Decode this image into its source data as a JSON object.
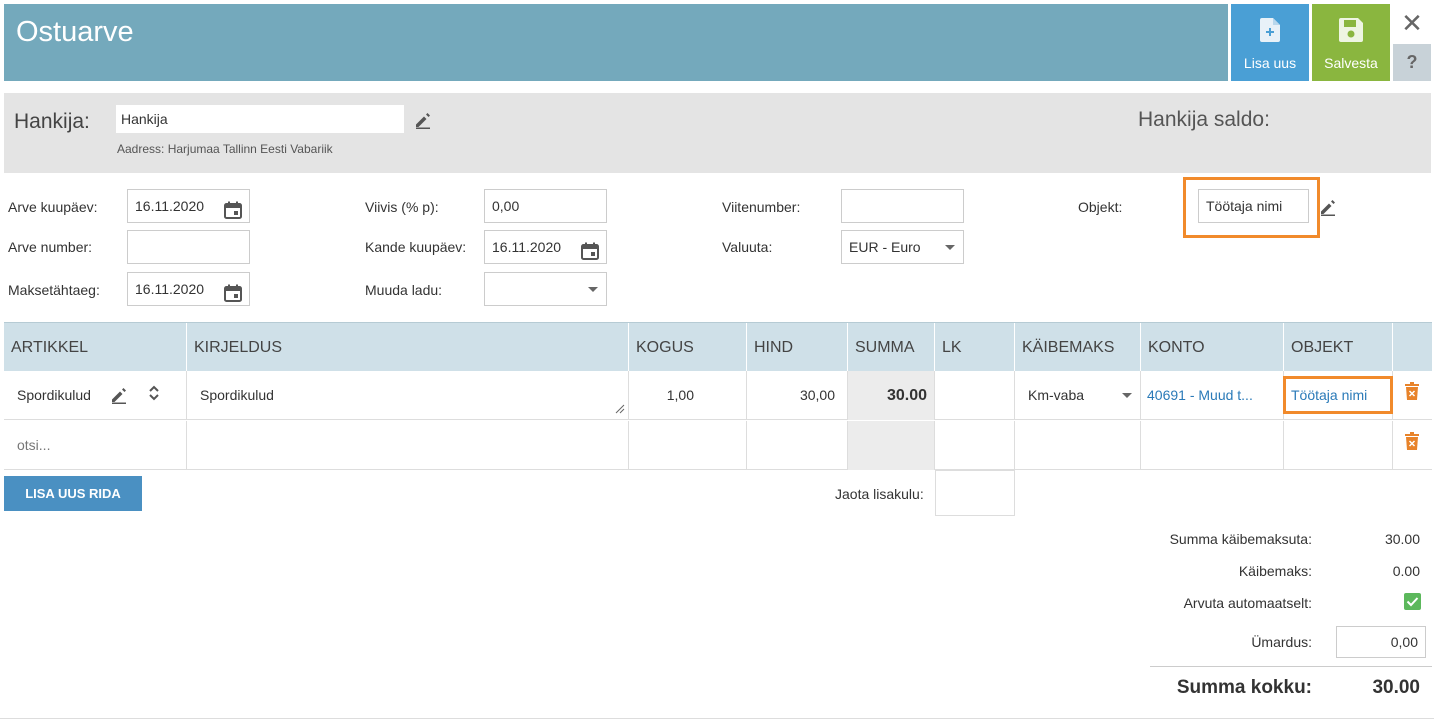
{
  "header": {
    "title": "Ostuarve",
    "add_new_label": "Lisa uus",
    "save_label": "Salvesta",
    "close_label": "✕",
    "help_label": "?"
  },
  "vendor": {
    "label": "Hankija:",
    "value": "Hankija",
    "address": "Aadress: Harjumaa Tallinn Eesti Vabariik",
    "saldo_label": "Hankija saldo:"
  },
  "form": {
    "arve_kuupaev": {
      "label": "Arve kuupäev:",
      "value": "16.11.2020"
    },
    "arve_number": {
      "label": "Arve number:",
      "value": ""
    },
    "maksetahtaeg": {
      "label": "Maksetähtaeg:",
      "value": "16.11.2020"
    },
    "viivis": {
      "label": "Viivis (% p):",
      "value": "0,00"
    },
    "kande_kuupaev": {
      "label": "Kande kuupäev:",
      "value": "16.11.2020"
    },
    "muuda_ladu": {
      "label": "Muuda ladu:",
      "value": ""
    },
    "viitenumber": {
      "label": "Viitenumber:",
      "value": ""
    },
    "valuuta": {
      "label": "Valuuta:",
      "value": "EUR - Euro"
    },
    "objekt": {
      "label": "Objekt:",
      "value": "Töötaja nimi"
    }
  },
  "table": {
    "columns": [
      "ARTIKKEL",
      "KIRJELDUS",
      "KOGUS",
      "HIND",
      "SUMMA",
      "LK",
      "KÄIBEMAKS",
      "KONTO",
      "OBJEKT"
    ],
    "rows": [
      {
        "artikkel": "Spordikulud",
        "kirjeldus": "Spordikulud",
        "kogus": "1,00",
        "hind": "30,00",
        "summa": "30.00",
        "lk": "",
        "kaibemaks": "Km-vaba",
        "konto": "40691 - Muud t...",
        "objekt": "Töötaja nimi"
      }
    ],
    "search_placeholder": "otsi...",
    "add_row_label": "LISA UUS RIDA",
    "jaota_label": "Jaota lisakulu:"
  },
  "totals": {
    "summa_kaibemaksuta_label": "Summa käibemaksuta:",
    "summa_kaibemaksuta": "30.00",
    "kaibemaks_label": "Käibemaks:",
    "kaibemaks": "0.00",
    "arvuta_label": "Arvuta automaatselt:",
    "arvuta_checked": true,
    "umardus_label": "Ümardus:",
    "umardus": "0,00",
    "summa_kokku_label": "Summa kokku:",
    "summa_kokku": "30.00"
  },
  "colors": {
    "header_bg": "#74a9bc",
    "add_btn": "#4a9fd5",
    "save_btn": "#8ab63f",
    "highlight": "#f18a2b",
    "link": "#2a7ab8",
    "trash": "#e8832a"
  }
}
